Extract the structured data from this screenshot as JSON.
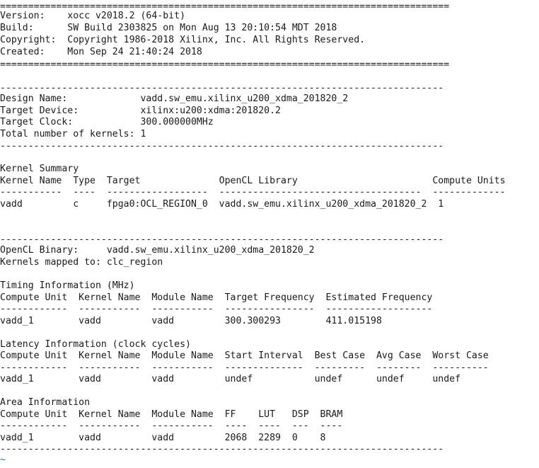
{
  "terminal": {
    "lines": [
      "================================================================================",
      "Version:    xocc v2018.2 (64-bit)",
      "Build:      SW Build 2303825 on Mon Aug 13 20:10:54 MDT 2018",
      "Copyright:  Copyright 1986-2018 Xilinx, Inc. All Rights Reserved.",
      "Created:    Mon Sep 24 21:40:24 2018",
      "================================================================================",
      "",
      "-------------------------------------------------------------------------------",
      "Design Name:             vadd.sw_emu.xilinx_u200_xdma_201820_2",
      "Target Device:           xilinx:u200:xdma:201820.2",
      "Target Clock:            300.000000MHz",
      "Total number of kernels: 1",
      "-------------------------------------------------------------------------------",
      "",
      "Kernel Summary",
      "Kernel Name  Type  Target              OpenCL Library                        Compute Units",
      "-----------  ----  ------------------  ------------------------------------  -------------",
      "vadd         c     fpga0:OCL_REGION_0  vadd.sw_emu.xilinx_u200_xdma_201820_2  1",
      "",
      "",
      "-------------------------------------------------------------------------------",
      "OpenCL Binary:     vadd.sw_emu.xilinx_u200_xdma_201820_2",
      "Kernels mapped to: clc_region",
      "",
      "Timing Information (MHz)",
      "Compute Unit  Kernel Name  Module Name  Target Frequency  Estimated Frequency",
      "------------  -----------  -----------  ----------------  -------------------",
      "vadd_1        vadd         vadd         300.300293        411.015198",
      "",
      "Latency Information (clock cycles)",
      "Compute Unit  Kernel Name  Module Name  Start Interval  Best Case  Avg Case  Worst Case",
      "------------  -----------  -----------  --------------  ---------  --------  ----------",
      "vadd_1        vadd         vadd         undef           undef      undef     undef",
      "",
      "Area Information",
      "Compute Unit  Kernel Name  Module Name  FF    LUT   DSP  BRAM",
      "------------  -----------  -----------  ----  ----  ---  ----",
      "vadd_1        vadd         vadd         2068  2289  0    8",
      "-------------------------------------------------------------------------------"
    ],
    "tilde": "~"
  }
}
